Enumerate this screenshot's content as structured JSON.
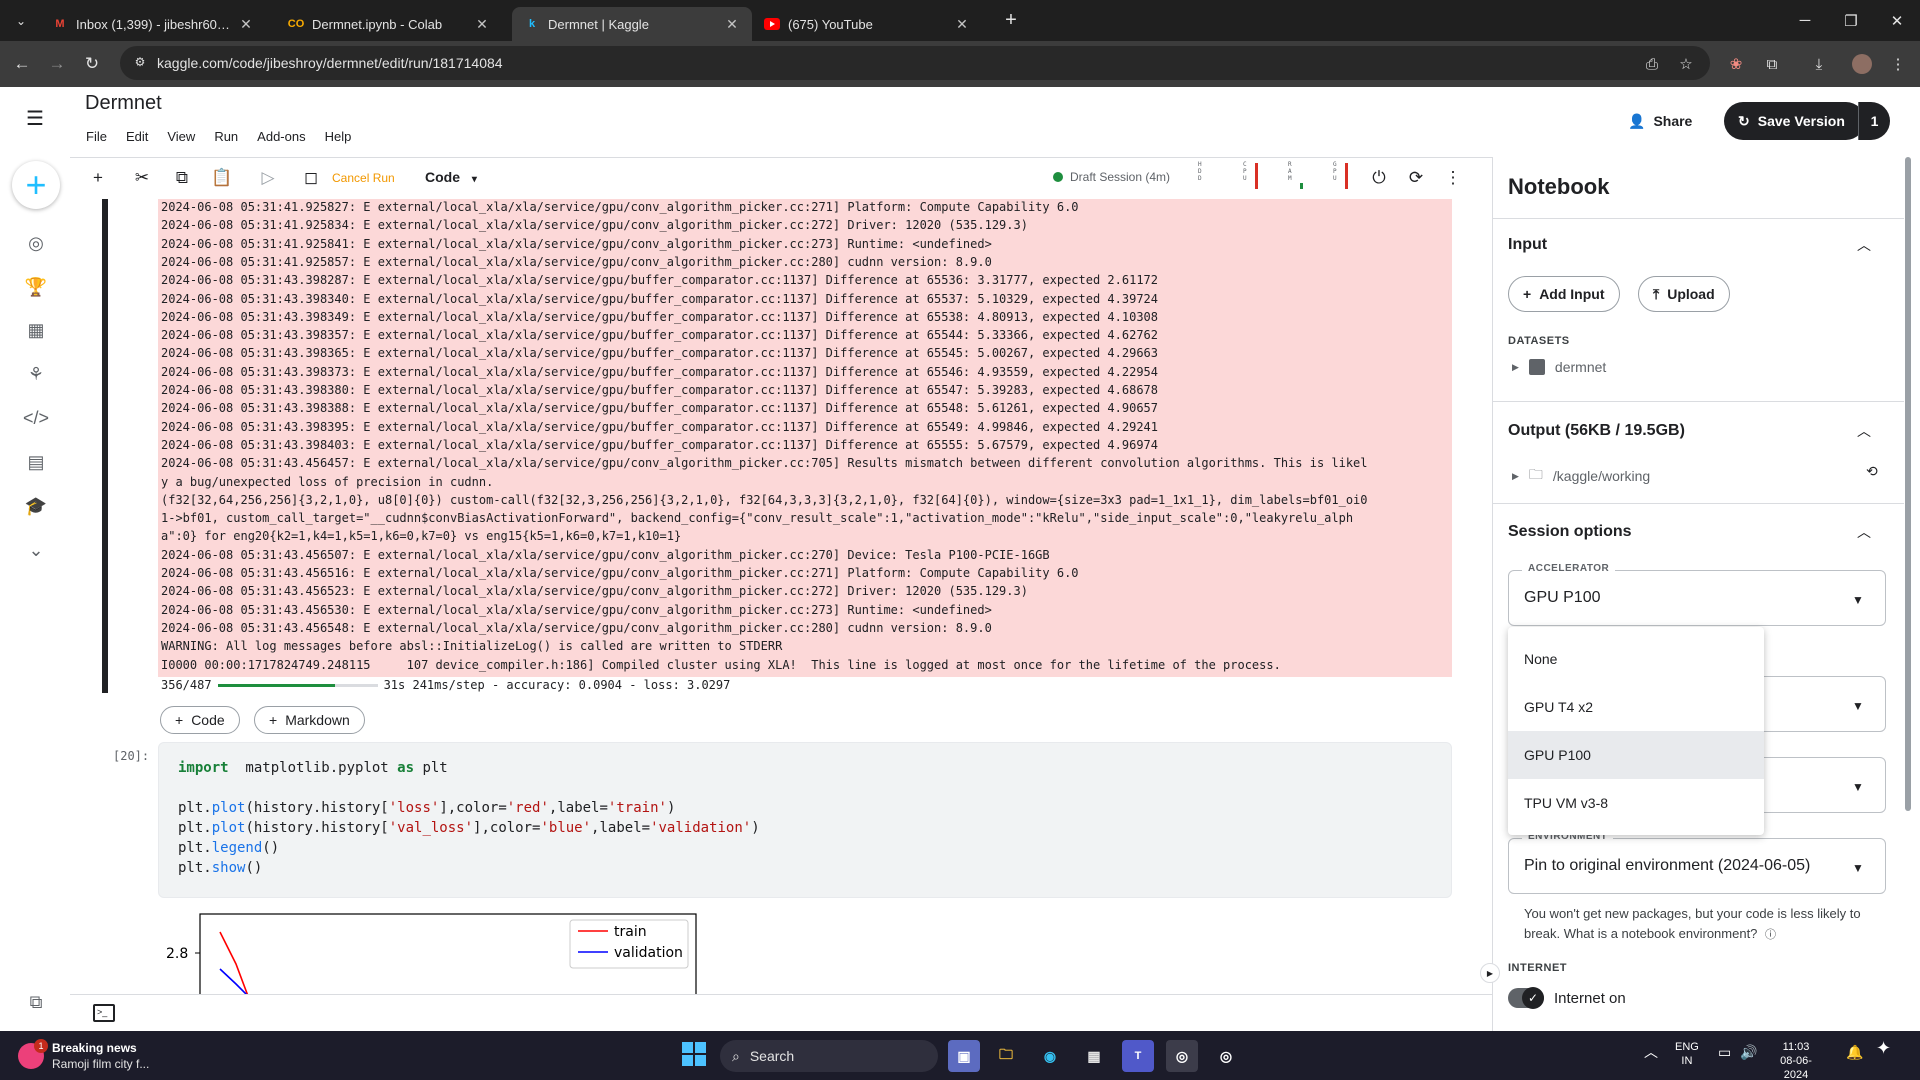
{
  "browser": {
    "tabs": [
      {
        "title": "Inbox (1,399) - jibeshr60@gmai",
        "favicon": "gmail-icon",
        "color": "#ea4335",
        "active": false
      },
      {
        "title": "Dermnet.ipynb - Colab",
        "favicon": "colab-icon",
        "color": "#f9ab00",
        "active": false
      },
      {
        "title": "Dermnet | Kaggle",
        "favicon": "kaggle-icon",
        "color": "#20beff",
        "active": true
      },
      {
        "title": "(675) YouTube",
        "favicon": "youtube-icon",
        "color": "#ff0000",
        "active": false
      }
    ],
    "url": "kaggle.com/code/jibeshroy/dermnet/edit/run/181714084"
  },
  "header": {
    "title": "Dermnet",
    "menu": [
      "File",
      "Edit",
      "View",
      "Run",
      "Add-ons",
      "Help"
    ],
    "share_label": "Share",
    "save_label": "Save Version",
    "save_count": "1"
  },
  "toolbar": {
    "cancel_label": "Cancel Run",
    "cell_type": "Code",
    "session": "Draft Session (4m)",
    "meters": [
      "HDD",
      "CPU",
      "RAM",
      "GPU"
    ]
  },
  "output": {
    "lines": [
      "2024-06-08 05:31:41.925827: E external/local_xla/xla/service/gpu/conv_algorithm_picker.cc:271] Platform: Compute Capability 6.0",
      "2024-06-08 05:31:41.925834: E external/local_xla/xla/service/gpu/conv_algorithm_picker.cc:272] Driver: 12020 (535.129.3)",
      "2024-06-08 05:31:41.925841: E external/local_xla/xla/service/gpu/conv_algorithm_picker.cc:273] Runtime: <undefined>",
      "2024-06-08 05:31:41.925857: E external/local_xla/xla/service/gpu/conv_algorithm_picker.cc:280] cudnn version: 8.9.0",
      "2024-06-08 05:31:43.398287: E external/local_xla/xla/service/gpu/buffer_comparator.cc:1137] Difference at 65536: 3.31777, expected 2.61172",
      "2024-06-08 05:31:43.398340: E external/local_xla/xla/service/gpu/buffer_comparator.cc:1137] Difference at 65537: 5.10329, expected 4.39724",
      "2024-06-08 05:31:43.398349: E external/local_xla/xla/service/gpu/buffer_comparator.cc:1137] Difference at 65538: 4.80913, expected 4.10308",
      "2024-06-08 05:31:43.398357: E external/local_xla/xla/service/gpu/buffer_comparator.cc:1137] Difference at 65544: 5.33366, expected 4.62762",
      "2024-06-08 05:31:43.398365: E external/local_xla/xla/service/gpu/buffer_comparator.cc:1137] Difference at 65545: 5.00267, expected 4.29663",
      "2024-06-08 05:31:43.398373: E external/local_xla/xla/service/gpu/buffer_comparator.cc:1137] Difference at 65546: 4.93559, expected 4.22954",
      "2024-06-08 05:31:43.398380: E external/local_xla/xla/service/gpu/buffer_comparator.cc:1137] Difference at 65547: 5.39283, expected 4.68678",
      "2024-06-08 05:31:43.398388: E external/local_xla/xla/service/gpu/buffer_comparator.cc:1137] Difference at 65548: 5.61261, expected 4.90657",
      "2024-06-08 05:31:43.398395: E external/local_xla/xla/service/gpu/buffer_comparator.cc:1137] Difference at 65549: 4.99846, expected 4.29241",
      "2024-06-08 05:31:43.398403: E external/local_xla/xla/service/gpu/buffer_comparator.cc:1137] Difference at 65555: 5.67579, expected 4.96974",
      "2024-06-08 05:31:43.456457: E external/local_xla/xla/service/gpu/conv_algorithm_picker.cc:705] Results mismatch between different convolution algorithms. This is likel",
      "y a bug/unexpected loss of precision in cudnn.",
      "(f32[32,64,256,256]{3,2,1,0}, u8[0]{0}) custom-call(f32[32,3,256,256]{3,2,1,0}, f32[64,3,3,3]{3,2,1,0}, f32[64]{0}), window={size=3x3 pad=1_1x1_1}, dim_labels=bf01_oi0",
      "1->bf01, custom_call_target=\"__cudnn$convBiasActivationForward\", backend_config={\"conv_result_scale\":1,\"activation_mode\":\"kRelu\",\"side_input_scale\":0,\"leakyrelu_alph",
      "a\":0} for eng20{k2=1,k4=1,k5=1,k6=0,k7=0} vs eng15{k5=1,k6=0,k7=1,k10=1}",
      "2024-06-08 05:31:43.456507: E external/local_xla/xla/service/gpu/conv_algorithm_picker.cc:270] Device: Tesla P100-PCIE-16GB",
      "2024-06-08 05:31:43.456516: E external/local_xla/xla/service/gpu/conv_algorithm_picker.cc:271] Platform: Compute Capability 6.0",
      "2024-06-08 05:31:43.456523: E external/local_xla/xla/service/gpu/conv_algorithm_picker.cc:272] Driver: 12020 (535.129.3)",
      "2024-06-08 05:31:43.456530: E external/local_xla/xla/service/gpu/conv_algorithm_picker.cc:273] Runtime: <undefined>",
      "2024-06-08 05:31:43.456548: E external/local_xla/xla/service/gpu/conv_algorithm_picker.cc:280] cudnn version: 8.9.0",
      "WARNING: All log messages before absl::InitializeLog() is called are written to STDERR",
      "I0000 00:00:1717824749.248115     107 device_compiler.h:186] Compiled cluster using XLA!  This line is logged at most once for the lifetime of the process."
    ],
    "progress_count": "356/487",
    "progress_fraction": 0.731,
    "progress_stats": "31s 241ms/step - accuracy: 0.0904 - loss: 3.0297"
  },
  "add_cell": {
    "code_label": "Code",
    "markdown_label": "Markdown"
  },
  "cell": {
    "number": "[20]:",
    "code": [
      [
        [
          "kw",
          "import"
        ],
        [
          "",
          "  matplotlib.pyplot "
        ],
        [
          "kw",
          "as"
        ],
        [
          "",
          " plt"
        ]
      ],
      [],
      [
        [
          "",
          "plt."
        ],
        [
          "fn",
          "plot"
        ],
        [
          "",
          "(history.history["
        ],
        [
          "str",
          "'loss'"
        ],
        [
          "",
          "],color="
        ],
        [
          "str",
          "'red'"
        ],
        [
          "",
          ",label="
        ],
        [
          "str",
          "'train'"
        ],
        [
          "",
          ")"
        ]
      ],
      [
        [
          "",
          "plt."
        ],
        [
          "fn",
          "plot"
        ],
        [
          "",
          "(history.history["
        ],
        [
          "str",
          "'val_loss'"
        ],
        [
          "",
          "],color="
        ],
        [
          "str",
          "'blue'"
        ],
        [
          "",
          ",label="
        ],
        [
          "str",
          "'validation'"
        ],
        [
          "",
          ")"
        ]
      ],
      [
        [
          "",
          "plt."
        ],
        [
          "fn",
          "legend"
        ],
        [
          "",
          "()"
        ]
      ],
      [
        [
          "",
          "plt."
        ],
        [
          "fn",
          "show"
        ],
        [
          "",
          "()"
        ]
      ]
    ]
  },
  "chart_data": {
    "type": "line",
    "ytick": "2.8",
    "series": [
      {
        "name": "train",
        "color": "#ff0000"
      },
      {
        "name": "validation",
        "color": "#0000ff"
      }
    ]
  },
  "panel": {
    "title": "Notebook",
    "input_title": "Input",
    "add_input_label": "Add Input",
    "upload_label": "Upload",
    "datasets_label": "DATASETS",
    "dataset_name": "dermnet",
    "output_title": "Output (56KB / 19.5GB)",
    "output_path": "/kaggle/working",
    "session_title": "Session options",
    "accelerator_label": "ACCELERATOR",
    "accelerator_value": "GPU P100",
    "accelerator_options": [
      "None",
      "GPU T4 x2",
      "GPU P100",
      "TPU VM v3-8"
    ],
    "environment_label": "ENVIRONMENT",
    "environment_value": "Pin to original environment (2024-06-05)",
    "environment_help": "You won't get new packages, but your code is less likely to break. What is a notebook environment?",
    "internet_label": "INTERNET",
    "internet_value": "Internet on"
  },
  "taskbar": {
    "news_title": "Breaking news",
    "news_sub": "Ramoji film city f...",
    "news_badge": "1",
    "search_label": "Search",
    "lang": "ENG",
    "region": "IN",
    "time": "11:03",
    "date": "08-06-2024"
  }
}
